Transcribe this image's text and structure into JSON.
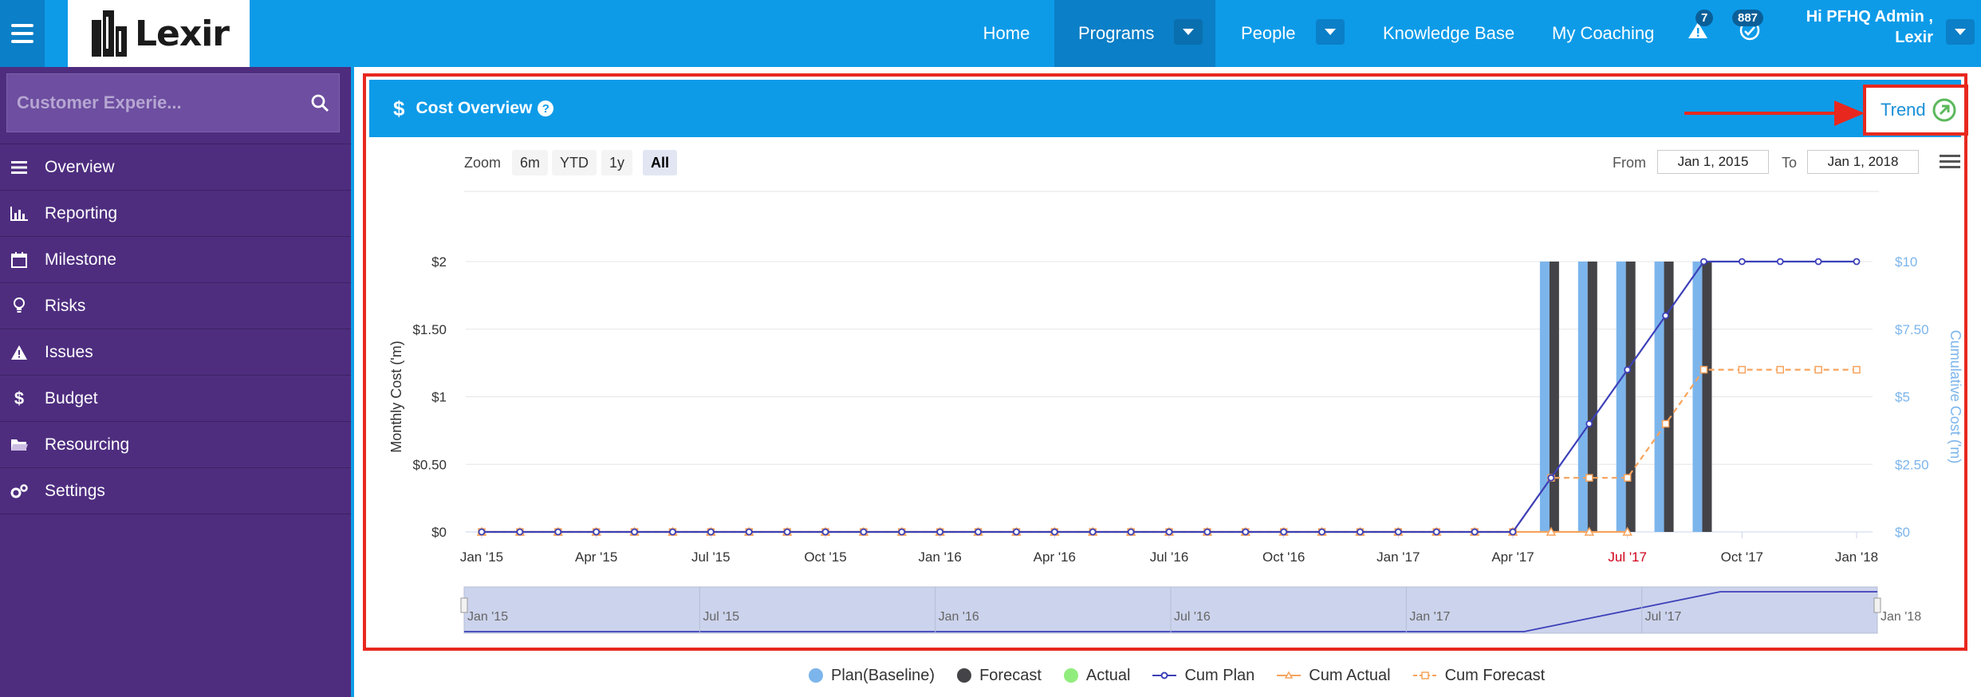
{
  "app": {
    "logo_text": "Lexir",
    "nav": [
      {
        "label": "Home"
      },
      {
        "label": "Programs"
      },
      {
        "label": "People"
      },
      {
        "label": "Knowledge Base"
      },
      {
        "label": "My Coaching"
      }
    ],
    "alerts_count": "7",
    "notifications_count": "887",
    "greeting_line1": "Hi PFHQ Admin ,",
    "greeting_line2": "Lexir"
  },
  "sidebar": {
    "search_value": "Customer Experie...",
    "items": [
      {
        "label": "Overview",
        "icon": "list-icon"
      },
      {
        "label": "Reporting",
        "icon": "bar-chart-icon"
      },
      {
        "label": "Milestone",
        "icon": "calendar-icon"
      },
      {
        "label": "Risks",
        "icon": "lightbulb-icon"
      },
      {
        "label": "Issues",
        "icon": "warning-icon"
      },
      {
        "label": "Budget",
        "icon": "dollar-icon"
      },
      {
        "label": "Resourcing",
        "icon": "folder-icon"
      },
      {
        "label": "Settings",
        "icon": "gears-icon"
      }
    ]
  },
  "panel": {
    "title": "Cost Overview",
    "trend_label": "Trend"
  },
  "controls": {
    "zoom_label": "Zoom",
    "zoom_options": [
      "6m",
      "YTD",
      "1y",
      "All"
    ],
    "zoom_selected": "All",
    "from_label": "From",
    "from_value": "Jan 1, 2015",
    "to_label": "To",
    "to_value": "Jan 1, 2018"
  },
  "colors": {
    "plan": "#7cb5ec",
    "forecast": "#434348",
    "actual": "#90ed7d",
    "cum_plan": "#3c40b8",
    "cum_actual": "#f7a35c",
    "cum_forecast": "#f7a35c",
    "highlight": "#e8281e",
    "brand": "#0d9be8",
    "sidebar": "#4e2d7f"
  },
  "chart_data": {
    "type": "bar",
    "x_tick_labels": [
      "Jan '15",
      "Apr '15",
      "Jul '15",
      "Oct '15",
      "Jan '16",
      "Apr '16",
      "Jul '16",
      "Oct '16",
      "Jan '17",
      "Apr '17",
      "Jul '17",
      "Oct '17",
      "Jan '18"
    ],
    "highlighted_tick": "Jul '17",
    "navigator_labels": [
      "Jan '15",
      "Jul '15",
      "Jan '16",
      "Jul '16",
      "Jan '17",
      "Jul '17",
      "Jan '18"
    ],
    "ylabel_left": "Monthly Cost ('m)",
    "ylabel_right": "Cumulative Cost ('m)",
    "y_left_ticks": [
      "$0",
      "$0.50",
      "$1",
      "$1.50",
      "$2"
    ],
    "y_right_ticks": [
      "$0",
      "$2.50",
      "$5",
      "$7.50",
      "$10"
    ],
    "ylim_left": [
      0,
      2
    ],
    "ylim_right": [
      0,
      10
    ],
    "months": [
      "2015-01",
      "2015-02",
      "2015-03",
      "2015-04",
      "2015-05",
      "2015-06",
      "2015-07",
      "2015-08",
      "2015-09",
      "2015-10",
      "2015-11",
      "2015-12",
      "2016-01",
      "2016-02",
      "2016-03",
      "2016-04",
      "2016-05",
      "2016-06",
      "2016-07",
      "2016-08",
      "2016-09",
      "2016-10",
      "2016-11",
      "2016-12",
      "2017-01",
      "2017-02",
      "2017-03",
      "2017-04",
      "2017-05",
      "2017-06",
      "2017-07",
      "2017-08",
      "2017-09",
      "2017-10",
      "2017-11",
      "2017-12",
      "2018-01"
    ],
    "series": [
      {
        "name": "Plan(Baseline)",
        "kind": "column",
        "values": [
          0,
          0,
          0,
          0,
          0,
          0,
          0,
          0,
          0,
          0,
          0,
          0,
          0,
          0,
          0,
          0,
          0,
          0,
          0,
          0,
          0,
          0,
          0,
          0,
          0,
          0,
          0,
          0,
          2,
          2,
          2,
          2,
          2,
          0,
          0,
          0,
          0
        ]
      },
      {
        "name": "Forecast",
        "kind": "column",
        "values": [
          0,
          0,
          0,
          0,
          0,
          0,
          0,
          0,
          0,
          0,
          0,
          0,
          0,
          0,
          0,
          0,
          0,
          0,
          0,
          0,
          0,
          0,
          0,
          0,
          0,
          0,
          0,
          0,
          2,
          2,
          2,
          2,
          2,
          0,
          0,
          0,
          0
        ]
      },
      {
        "name": "Actual",
        "kind": "column",
        "values": [
          0,
          0,
          0,
          0,
          0,
          0,
          0,
          0,
          0,
          0,
          0,
          0,
          0,
          0,
          0,
          0,
          0,
          0,
          0,
          0,
          0,
          0,
          0,
          0,
          0,
          0,
          0,
          0,
          0,
          0,
          0,
          0,
          0,
          0,
          0,
          0,
          0
        ]
      },
      {
        "name": "Cum Plan",
        "kind": "line",
        "values": [
          0,
          0,
          0,
          0,
          0,
          0,
          0,
          0,
          0,
          0,
          0,
          0,
          0,
          0,
          0,
          0,
          0,
          0,
          0,
          0,
          0,
          0,
          0,
          0,
          0,
          0,
          0,
          0,
          2,
          4,
          6,
          8,
          10,
          10,
          10,
          10,
          10
        ]
      },
      {
        "name": "Cum Actual",
        "kind": "line",
        "values": [
          0,
          0,
          0,
          0,
          0,
          0,
          0,
          0,
          0,
          0,
          0,
          0,
          0,
          0,
          0,
          0,
          0,
          0,
          0,
          0,
          0,
          0,
          0,
          0,
          0,
          0,
          0,
          0,
          0,
          0,
          0
        ]
      },
      {
        "name": "Cum Forecast",
        "kind": "line",
        "values": [
          0,
          0,
          0,
          0,
          0,
          0,
          0,
          0,
          0,
          0,
          0,
          0,
          0,
          0,
          0,
          0,
          0,
          0,
          0,
          0,
          0,
          0,
          0,
          0,
          0,
          0,
          0,
          0,
          2,
          2,
          2,
          4,
          6,
          6,
          6,
          6,
          6
        ]
      }
    ]
  }
}
